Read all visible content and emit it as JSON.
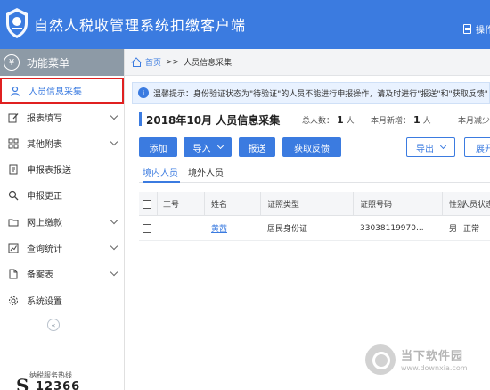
{
  "app": {
    "title": "自然人税收管理系统扣缴客户端",
    "header_action": "操作"
  },
  "sidebar": {
    "header": "功能菜单",
    "items": [
      {
        "label": "人员信息采集",
        "icon": "person-icon",
        "active": true
      },
      {
        "label": "报表填写",
        "icon": "edit-icon",
        "expandable": true
      },
      {
        "label": "其他附表",
        "icon": "grid-icon",
        "expandable": true
      },
      {
        "label": "申报表报送",
        "icon": "document-icon"
      },
      {
        "label": "申报更正",
        "icon": "search-icon"
      },
      {
        "label": "网上缴款",
        "icon": "folder-icon",
        "expandable": true
      },
      {
        "label": "查询统计",
        "icon": "chart-icon",
        "expandable": true
      },
      {
        "label": "备案表",
        "icon": "file-icon",
        "expandable": true
      },
      {
        "label": "系统设置",
        "icon": "gear-icon"
      }
    ],
    "collapse_glyph": "«",
    "hotline_label": "纳税服务热线",
    "hotline_s": "S",
    "hotline_number": "12366"
  },
  "breadcrumb": {
    "home": "首页",
    "separator": ">>",
    "current": "人员信息采集"
  },
  "notice": {
    "text": "温馨提示：身份验证状态为\"待验证\"的人员不能进行申报操作，请及时进行\"报送\"和\"获取反馈\""
  },
  "period": {
    "label": "2018年10月  人员信息采集"
  },
  "stats": {
    "total_label": "总人数：",
    "total_value": "1",
    "total_unit": "人",
    "new_label": "本月新增：",
    "new_value": "1",
    "new_unit": "人",
    "reduced_label": "本月减少"
  },
  "toolbar": {
    "add": "添加",
    "import": "导入",
    "submit": "报送",
    "feedback": "获取反馈",
    "export": "导出",
    "expand": "展开"
  },
  "tabs": [
    {
      "label": "境内人员",
      "active": true
    },
    {
      "label": "境外人员",
      "active": false
    }
  ],
  "table": {
    "headers": [
      "工号",
      "姓名",
      "证照类型",
      "证照号码",
      "性别",
      "人员状态"
    ],
    "rows": [
      {
        "id": "",
        "name": "黄茜",
        "id_type": "居民身份证",
        "id_number": "33038119970...",
        "gender": "男",
        "status": "正常"
      }
    ]
  },
  "watermark": {
    "cn": "当下软件园",
    "url": "www.downxia.com"
  },
  "colors": {
    "brand": "#3b7be0",
    "menu_header": "#8d9aa6",
    "active_outline": "#e02020"
  }
}
